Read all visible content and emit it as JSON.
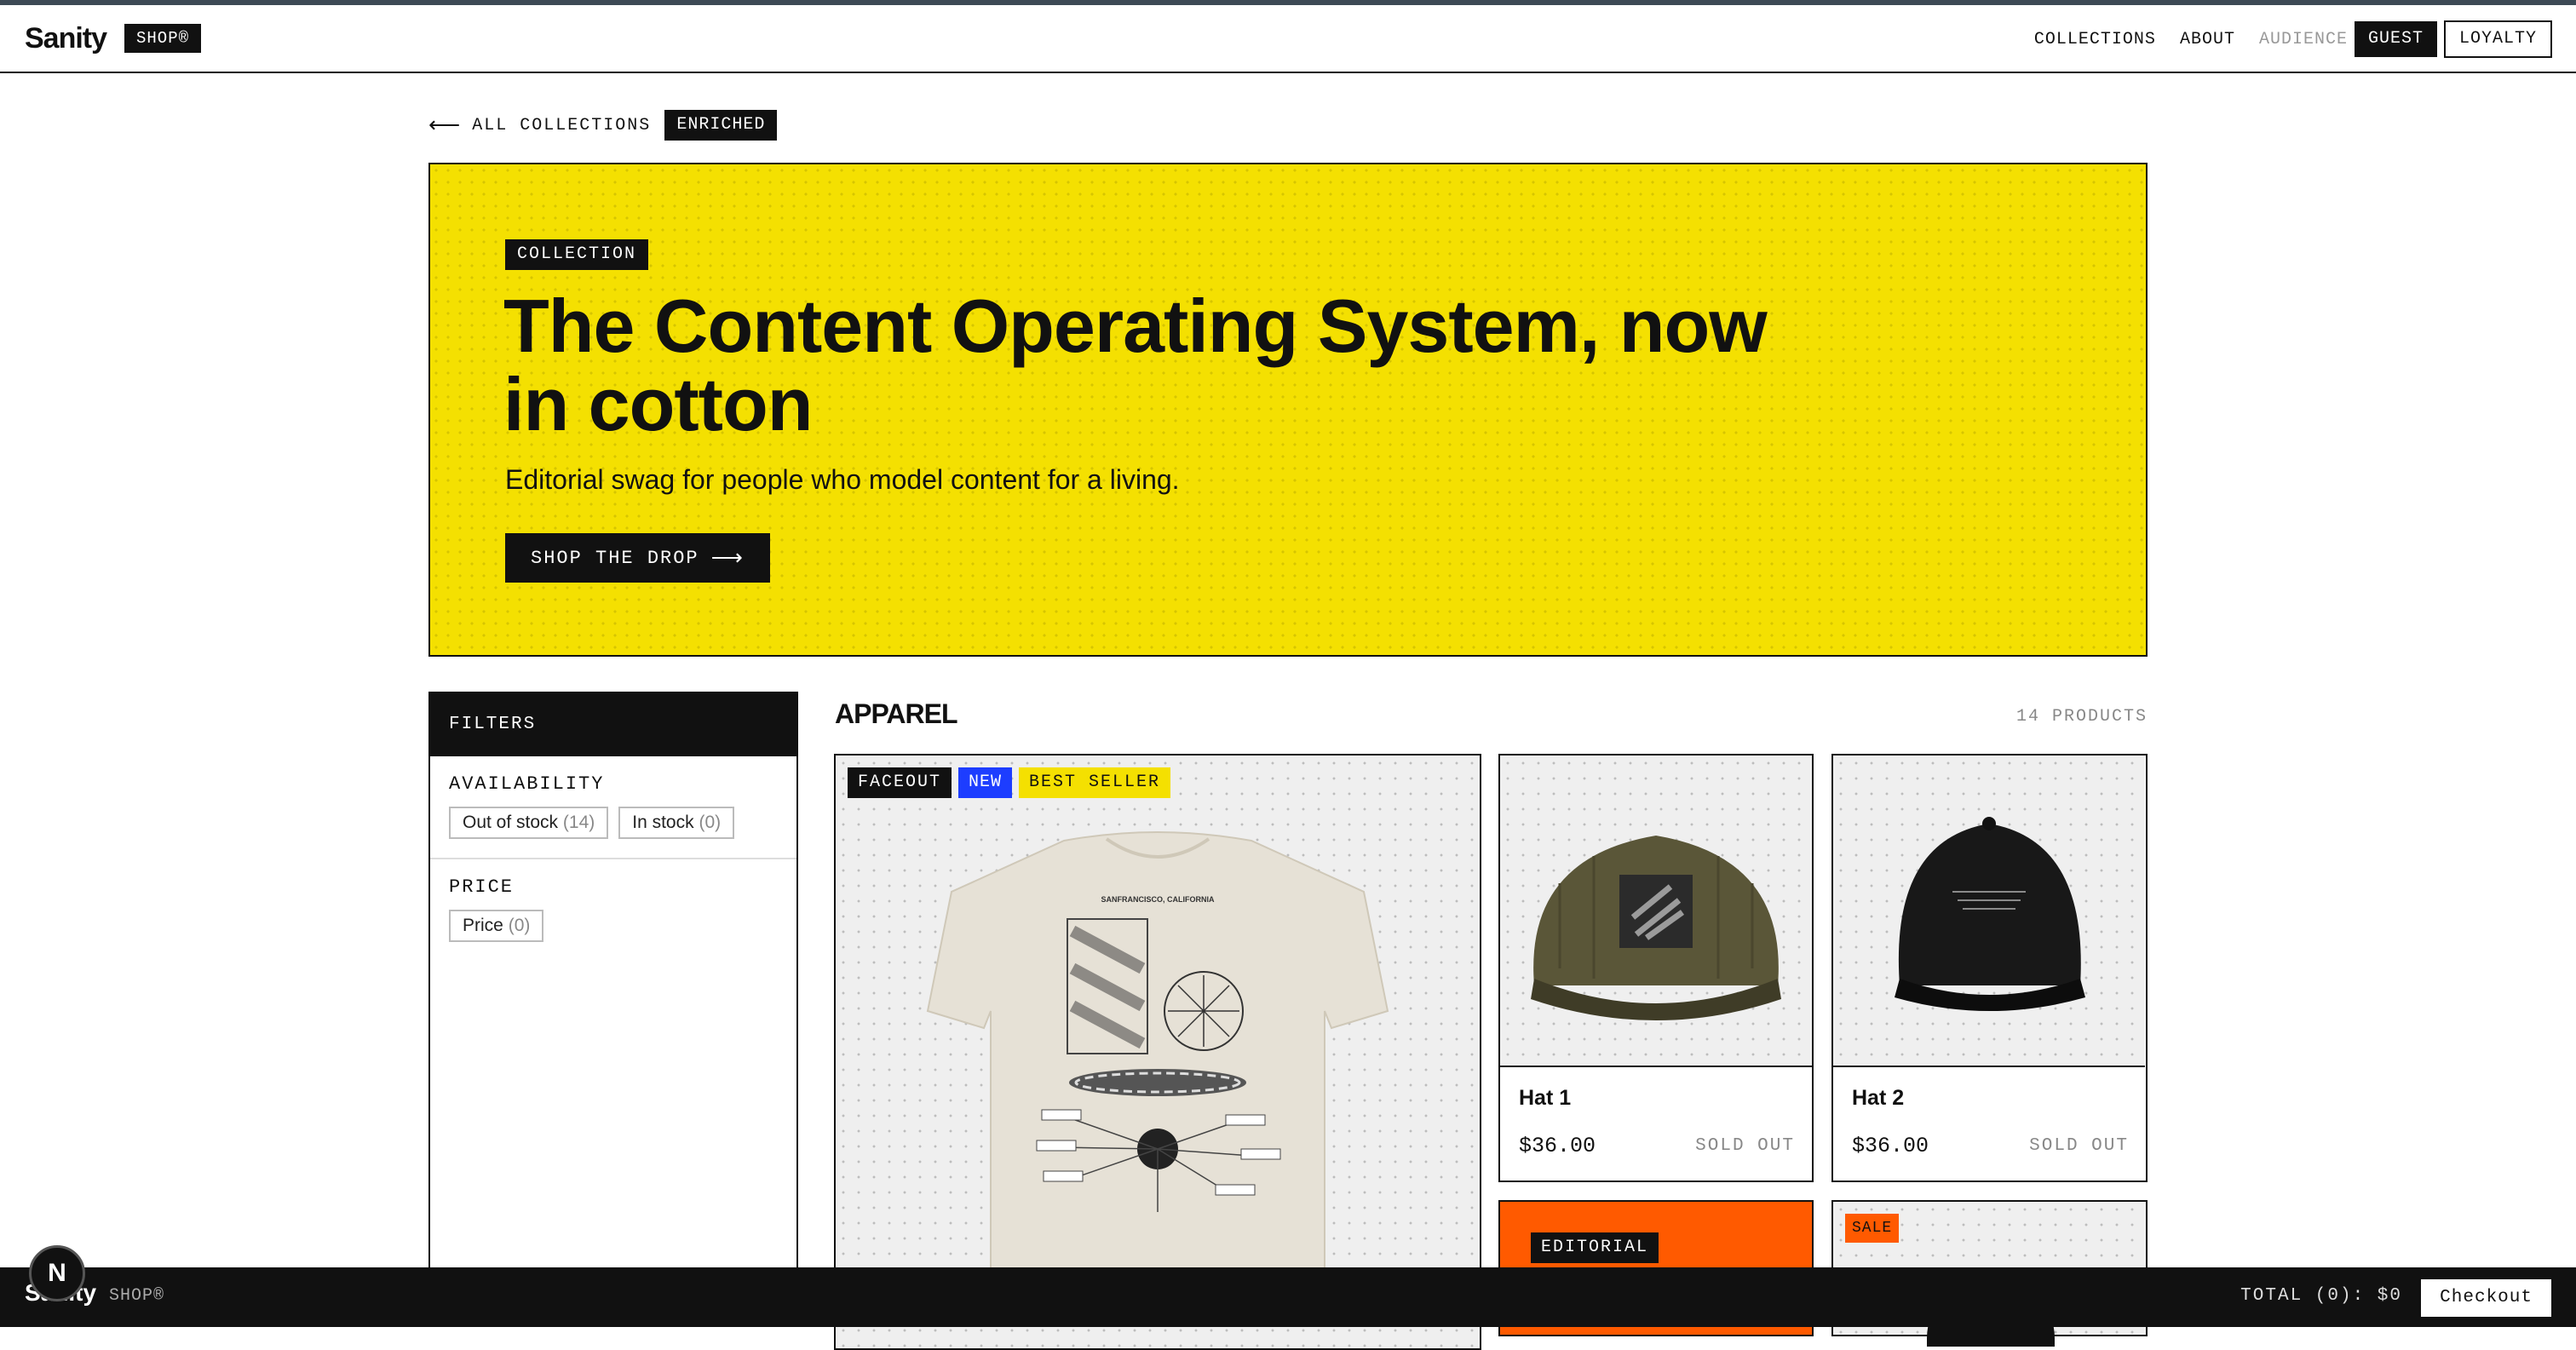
{
  "header": {
    "logo": "Sanity",
    "logo_tag": "SHOP®",
    "nav": {
      "collections": "COLLECTIONS",
      "about": "ABOUT",
      "audience": "AUDIENCE",
      "guest": "GUEST",
      "loyalty": "LOYALTY"
    }
  },
  "breadcrumb": {
    "arrow": "⟵",
    "label": "ALL COLLECTIONS",
    "badge": "ENRICHED"
  },
  "hero": {
    "pill": "COLLECTION",
    "title": "The Content Operating System, now in cotton",
    "subtitle": "Editorial swag for people who model content for a living.",
    "cta": "SHOP THE DROP",
    "cta_arrow": "⟶",
    "bg_color": "#f4e001"
  },
  "filters": {
    "title": "FILTERS",
    "availability": {
      "title": "AVAILABILITY",
      "options": [
        {
          "label": "Out of stock",
          "count": "(14)"
        },
        {
          "label": "In stock",
          "count": "(0)"
        }
      ]
    },
    "price": {
      "title": "PRICE",
      "options": [
        {
          "label": "Price",
          "count": "(0)"
        }
      ]
    }
  },
  "section": {
    "title": "APPAREL",
    "count": "14 PRODUCTS"
  },
  "featured": {
    "badges": [
      "FACEOUT",
      "NEW",
      "BEST SELLER"
    ],
    "print": "SANFRANCISCO, CALIFORNIA"
  },
  "products": [
    {
      "name": "Hat 1",
      "price": "$36.00",
      "status": "SOLD OUT",
      "icon": "olive-cap-icon"
    },
    {
      "name": "Hat 2",
      "price": "$36.00",
      "status": "SOLD OUT",
      "icon": "black-cap-icon"
    }
  ],
  "editorial": {
    "badge": "EDITORIAL"
  },
  "sale": {
    "badge": "SALE"
  },
  "footer": {
    "logo": "Sanity",
    "shop": "SHOP®",
    "total": "TOTAL (0): $0",
    "checkout": "Checkout"
  },
  "dev_badge": "N",
  "colors": {
    "accent_yellow": "#f4e001",
    "accent_blue": "#1d3dff",
    "accent_orange": "#ff5a00",
    "ink": "#111111"
  }
}
